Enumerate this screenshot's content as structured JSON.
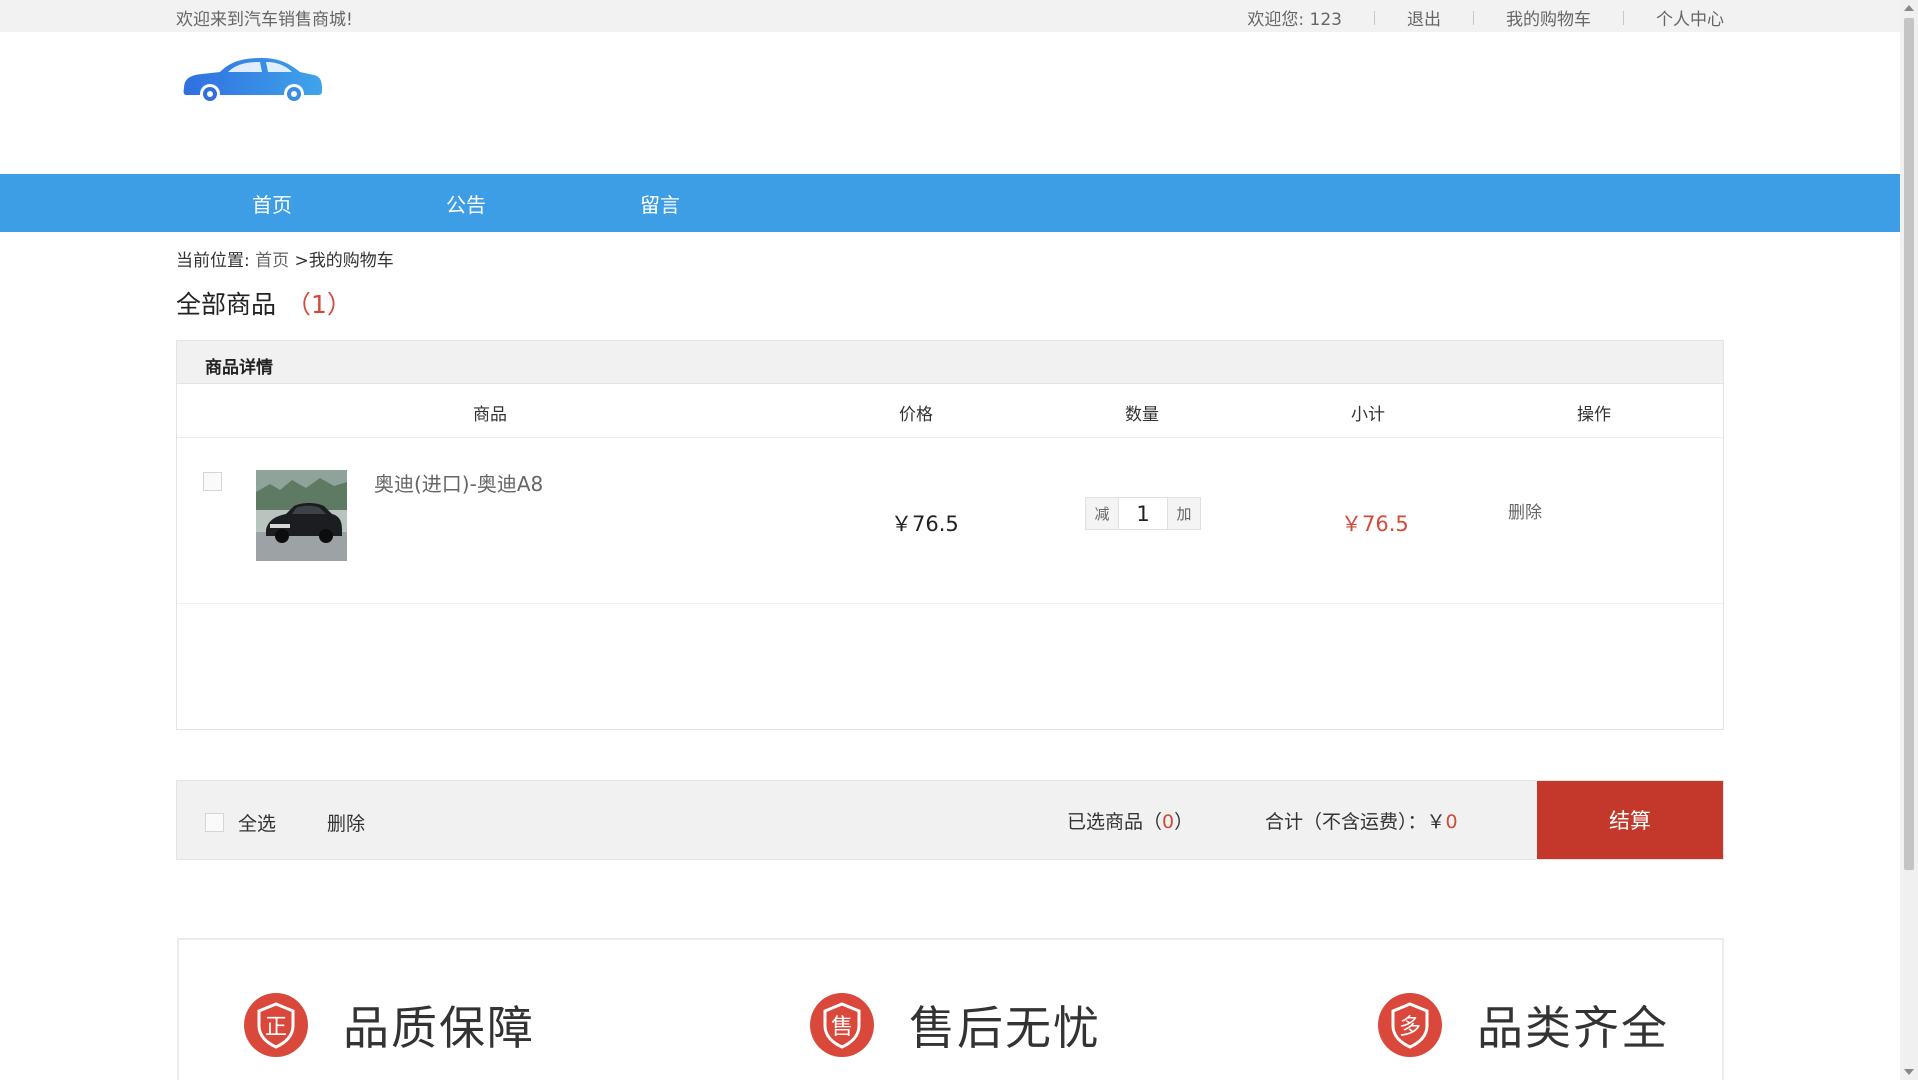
{
  "topbar": {
    "welcome": "欢迎来到汽车销售商城!",
    "greeting": "欢迎您: 123",
    "logout": "退出",
    "cart": "我的购物车",
    "profile": "个人中心"
  },
  "nav": {
    "home": "首页",
    "notice": "公告",
    "message": "留言"
  },
  "breadcrumb": {
    "prefix": "当前位置:",
    "home": "首页",
    "current": " >我的购物车"
  },
  "section": {
    "title": "全部商品",
    "count": "（1）"
  },
  "cart": {
    "header": "商品详情",
    "columns": {
      "product": "商品",
      "price": "价格",
      "quantity": "数量",
      "subtotal": "小计",
      "action": "操作"
    },
    "items": [
      {
        "name": "奥迪(进口)-奥迪A8",
        "price": "￥76.5",
        "qty_minus": "减",
        "quantity": "1",
        "qty_plus": "加",
        "subtotal": "￥76.5",
        "delete": "删除"
      }
    ]
  },
  "summary": {
    "select_all": "全选",
    "delete": "删除",
    "selected_label": "已选商品（",
    "selected_count": "0",
    "selected_suffix": "）",
    "total_label": "合计（不含运费）：￥",
    "total_value": "0",
    "checkout": "结算"
  },
  "guarantees": [
    {
      "icon": "正",
      "text": "品质保障"
    },
    {
      "icon": "售",
      "text": "售后无忧"
    },
    {
      "icon": "多",
      "text": "品类齐全"
    }
  ],
  "colors": {
    "nav": "#3d9ee6",
    "accent_red": "#d24a3a",
    "checkout": "#c4382b"
  }
}
